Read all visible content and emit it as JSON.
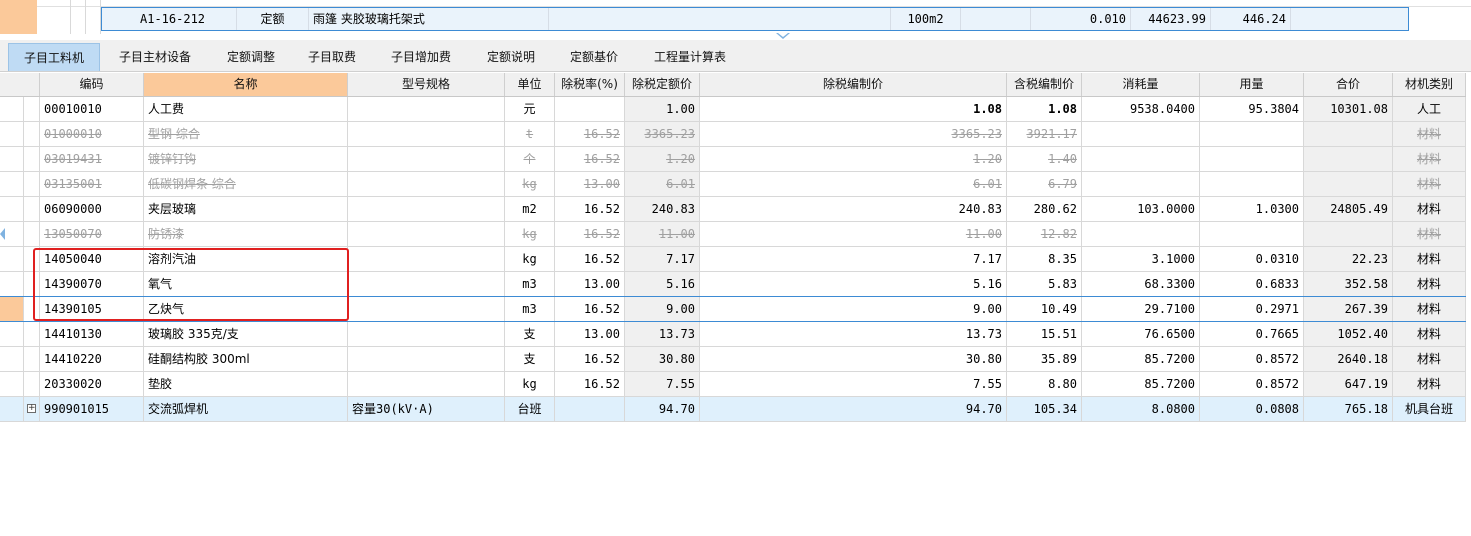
{
  "quota_row": {
    "code": "A1-16-212",
    "type": "定额",
    "name": "雨篷 夹胶玻璃托架式",
    "unit": "100m2",
    "qty": "0.010",
    "price": "44623.99",
    "total": "446.24"
  },
  "tabs": [
    {
      "label": "子目工料机",
      "active": true
    },
    {
      "label": "子目主材设备"
    },
    {
      "label": "定额调整"
    },
    {
      "label": "子目取费"
    },
    {
      "label": "子目增加费"
    },
    {
      "label": "定额说明"
    },
    {
      "label": "定额基价"
    },
    {
      "label": "工程量计算表"
    }
  ],
  "columns": [
    "编码",
    "名称",
    "型号规格",
    "单位",
    "除税率(%)",
    "除税定额价",
    "除税编制价",
    "含税编制价",
    "消耗量",
    "用量",
    "合价",
    "材机类别"
  ],
  "rows": [
    {
      "code": "00010010",
      "name": "人工费",
      "spec": "",
      "unit": "元",
      "rate": "",
      "base": "1.00",
      "tax_free": "1.08",
      "tax_incl": "1.08",
      "consume": "9538.0400",
      "usage": "95.3804",
      "total": "10301.08",
      "category": "人工"
    },
    {
      "code": "01000010",
      "name": "型钢 综合",
      "spec": "",
      "unit": "t",
      "rate": "16.52",
      "base": "3365.23",
      "tax_free": "3365.23",
      "tax_incl": "3921.17",
      "consume": "",
      "usage": "",
      "total": "",
      "category": "材料"
    },
    {
      "code": "03019431",
      "name": "镀锌钉钩",
      "spec": "",
      "unit": "个",
      "rate": "16.52",
      "base": "1.20",
      "tax_free": "1.20",
      "tax_incl": "1.40",
      "consume": "",
      "usage": "",
      "total": "",
      "category": "材料"
    },
    {
      "code": "03135001",
      "name": "低碳钢焊条 综合",
      "spec": "",
      "unit": "kg",
      "rate": "13.00",
      "base": "6.01",
      "tax_free": "6.01",
      "tax_incl": "6.79",
      "consume": "",
      "usage": "",
      "total": "",
      "category": "材料"
    },
    {
      "code": "06090000",
      "name": "夹层玻璃",
      "spec": "",
      "unit": "m2",
      "rate": "16.52",
      "base": "240.83",
      "tax_free": "240.83",
      "tax_incl": "280.62",
      "consume": "103.0000",
      "usage": "1.0300",
      "total": "24805.49",
      "category": "材料"
    },
    {
      "code": "13050070",
      "name": "防锈漆",
      "spec": "",
      "unit": "kg",
      "rate": "16.52",
      "base": "11.00",
      "tax_free": "11.00",
      "tax_incl": "12.82",
      "consume": "",
      "usage": "",
      "total": "",
      "category": "材料"
    },
    {
      "code": "14050040",
      "name": "溶剂汽油",
      "spec": "",
      "unit": "kg",
      "rate": "16.52",
      "base": "7.17",
      "tax_free": "7.17",
      "tax_incl": "8.35",
      "consume": "3.1000",
      "usage": "0.0310",
      "total": "22.23",
      "category": "材料"
    },
    {
      "code": "14390070",
      "name": "氧气",
      "spec": "",
      "unit": "m3",
      "rate": "13.00",
      "base": "5.16",
      "tax_free": "5.16",
      "tax_incl": "5.83",
      "consume": "68.3300",
      "usage": "0.6833",
      "total": "352.58",
      "category": "材料"
    },
    {
      "code": "14390105",
      "name": "乙炔气",
      "spec": "",
      "unit": "m3",
      "rate": "16.52",
      "base": "9.00",
      "tax_free": "9.00",
      "tax_incl": "10.49",
      "consume": "29.7100",
      "usage": "0.2971",
      "total": "267.39",
      "category": "材料"
    },
    {
      "code": "14410130",
      "name": "玻璃胶 335克/支",
      "spec": "",
      "unit": "支",
      "rate": "13.00",
      "base": "13.73",
      "tax_free": "13.73",
      "tax_incl": "15.51",
      "consume": "76.6500",
      "usage": "0.7665",
      "total": "1052.40",
      "category": "材料"
    },
    {
      "code": "14410220",
      "name": "硅酮结构胶 300ml",
      "spec": "",
      "unit": "支",
      "rate": "16.52",
      "base": "30.80",
      "tax_free": "30.80",
      "tax_incl": "35.89",
      "consume": "85.7200",
      "usage": "0.8572",
      "total": "2640.18",
      "category": "材料"
    },
    {
      "code": "20330020",
      "name": "垫胶",
      "spec": "",
      "unit": "kg",
      "rate": "16.52",
      "base": "7.55",
      "tax_free": "7.55",
      "tax_incl": "8.80",
      "consume": "85.7200",
      "usage": "0.8572",
      "total": "647.19",
      "category": "材料"
    },
    {
      "code": "990901015",
      "name": "交流弧焊机",
      "spec": "容量30(kV·A)",
      "unit": "台班",
      "rate": "",
      "base": "94.70",
      "tax_free": "94.70",
      "tax_incl": "105.34",
      "consume": "8.0800",
      "usage": "0.0808",
      "total": "765.18",
      "category": "机具台班"
    }
  ],
  "expand_symbol": "+"
}
